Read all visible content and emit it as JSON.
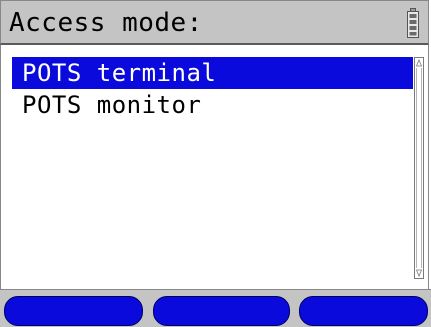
{
  "header": {
    "title": "Access mode:",
    "battery_icon": "battery-icon"
  },
  "menu": {
    "items": [
      {
        "label": "POTS terminal",
        "selected": true
      },
      {
        "label": "POTS monitor",
        "selected": false
      }
    ]
  },
  "softkeys": {
    "count": 3,
    "icons": [
      "softkey-1",
      "softkey-2",
      "softkey-3"
    ]
  },
  "colors": {
    "selection": "#0a0adc",
    "softkey": "#0a0adc",
    "title_bar": "#c4c4c4"
  }
}
